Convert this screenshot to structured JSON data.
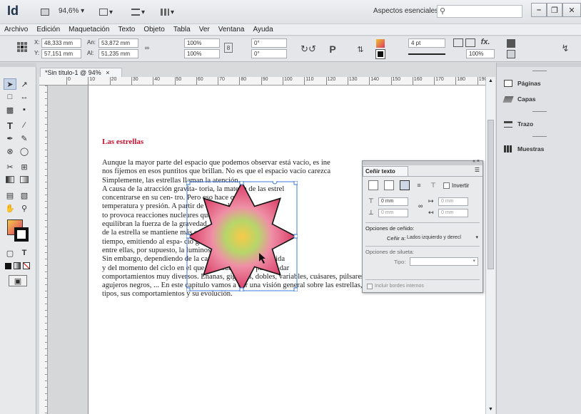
{
  "app": {
    "logo": "Id",
    "zoom": "94,6%",
    "workspace": "Aspectos esenciales",
    "search_placeholder": ""
  },
  "menu": [
    "Archivo",
    "Edición",
    "Maquetación",
    "Texto",
    "Objeto",
    "Tabla",
    "Ver",
    "Ventana",
    "Ayuda"
  ],
  "control": {
    "x_label": "X:",
    "x_value": "48,333 mm",
    "y_label": "Y:",
    "y_value": "57,151 mm",
    "w_label": "An:",
    "w_value": "53,872 mm",
    "h_label": "Al:",
    "h_value": "51,235 mm",
    "scale_x": "100%",
    "scale_y": "100%",
    "rotate": "0°",
    "shear": "0°",
    "stroke_weight": "4 pt",
    "opacity": "100%"
  },
  "document": {
    "tab_title": "*Sin título-1 @ 94%",
    "ruler_marks": [
      "0",
      "10",
      "20",
      "30",
      "40",
      "50",
      "60",
      "70",
      "80",
      "90",
      "100",
      "110",
      "120",
      "130",
      "140",
      "150",
      "160",
      "170",
      "180",
      "190"
    ]
  },
  "article": {
    "title": "Las estrellas",
    "lines": [
      "Aunque la mayor parte del espacio que podemos observar está vacío, es ine",
      "nos fijemos en esos puntitos que brillan. No es que el espacio vacío carezca",
      "Simplemente, las estrellas llaman          la          atención.",
      "A causa de la atracción gravita-                    toria, la materia de las estrel",
      "concentrarse en su cen-                                tro. Pero eso hace que",
      "temperatura y presión. A                              partir de ciertos límite",
      "to provoca reacciones                                  nucleares que libera",
      "equilibran la fuerza de                                la gravedad, con lo",
      "de la estrella se mantiene                             más o menos estable",
      "tiempo, emitiendo al espa-                           cio grandes cantidade",
      "entre ellas, por supuesto, la                         luminosa.",
      "Sin embargo, dependiendo de la                 cantidad de materia reunida",
      "y del momento del ciclo en el            que       se encuentra, se pueden dar",
      "comportamientos muy diversos. Enanas, gigantes, dobles, variables, cuásares, púlsares,",
      "agujeros negros, ... En este capítulo vamos a dar una visión general sobre las estrellas, sus",
      "tipos, sus comportamientos y su evolución."
    ]
  },
  "wrap_panel": {
    "title": "Ceñir texto",
    "invert_label": "Invertir",
    "top_value": "0 mm",
    "bottom_value": "0 mm",
    "left_value": "0 mm",
    "right_value": "0 mm",
    "wrap_options_heading": "Opciones de ceñido:",
    "wrap_to_label": "Ceñir a:",
    "wrap_to_value": "Lados izquierdo y derecl",
    "contour_heading": "Opciones de silueta:",
    "type_label": "Tipo:",
    "type_value": "",
    "include_edges_label": "Incluir bordes internos"
  },
  "dock": {
    "items": [
      {
        "label": "Páginas",
        "icon": "pages-icon"
      },
      {
        "label": "Capas",
        "icon": "layers-icon"
      },
      {
        "label": "Trazo",
        "icon": "stroke-icon"
      },
      {
        "label": "Muestras",
        "icon": "swatches-icon"
      }
    ]
  },
  "colors": {
    "title_red": "#c8102e",
    "star_outer": "#d93a64",
    "star_center": "#f7c948",
    "selection_blue": "#3d7bd9"
  }
}
